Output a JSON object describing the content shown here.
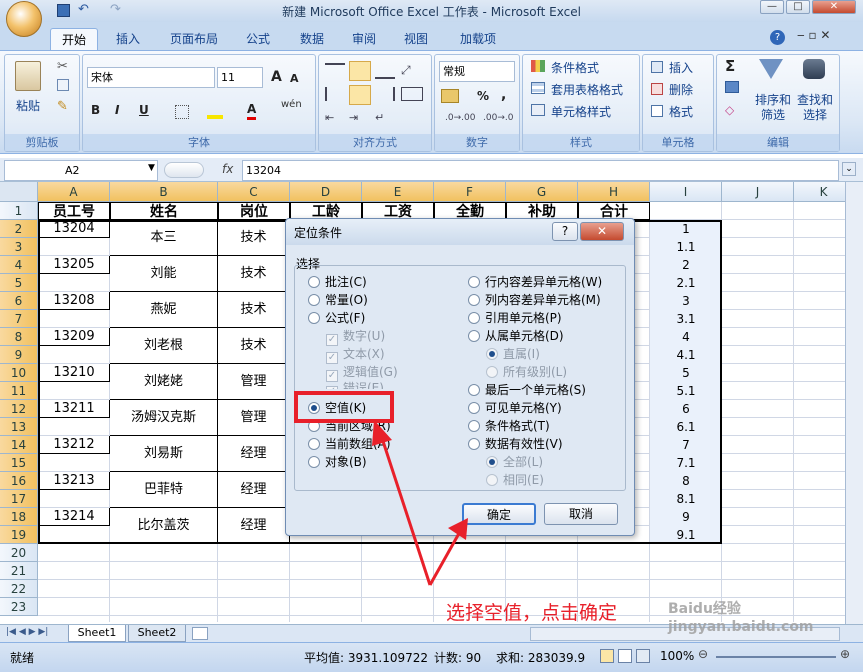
{
  "window": {
    "title": "新建 Microsoft Office Excel 工作表 - Microsoft Excel",
    "min": "—",
    "max": "□",
    "close": "✕"
  },
  "ribbon_tabs": [
    "开始",
    "插入",
    "页面布局",
    "公式",
    "数据",
    "审阅",
    "视图",
    "加载项"
  ],
  "ribbon": {
    "font_name": "宋体",
    "font_size": "11",
    "number_format": "常规",
    "groups": {
      "clipboard": "剪贴板",
      "font": "字体",
      "alignment": "对齐方式",
      "number": "数字",
      "styles": "样式",
      "cells": "单元格",
      "editing": "编辑"
    },
    "paste": "粘贴",
    "styles_items": [
      "条件格式",
      "套用表格格式",
      "单元格样式"
    ],
    "cells_items": [
      "插入",
      "删除",
      "格式"
    ],
    "editing_items": [
      "排序和",
      "筛选",
      "查找和",
      "选择"
    ],
    "sigma": "Σ",
    "bold": "B",
    "italic": "I",
    "underline": "U",
    "font_grow": "A",
    "font_color": "A",
    "wen": "wén",
    "pct": "%",
    "comma": ","
  },
  "formula_bar": {
    "name_box": "A2",
    "fx": "fx",
    "value": "13204"
  },
  "columns": [
    "A",
    "B",
    "C",
    "D",
    "E",
    "F",
    "G",
    "H",
    "I",
    "J",
    "K"
  ],
  "rows": [
    "1",
    "2",
    "3",
    "4",
    "5",
    "6",
    "7",
    "8",
    "9",
    "10",
    "11",
    "12",
    "13",
    "14",
    "15",
    "16",
    "17",
    "18",
    "19",
    "20",
    "21",
    "22",
    "23"
  ],
  "headers": [
    "员工号",
    "姓名",
    "岗位",
    "工龄",
    "工资",
    "全勤",
    "补助",
    "合计"
  ],
  "records": [
    {
      "id": "13204",
      "name": "本三",
      "post": "技术"
    },
    {
      "id": "13205",
      "name": "刘能",
      "post": "技术"
    },
    {
      "id": "13208",
      "name": "燕妮",
      "post": "技术"
    },
    {
      "id": "13209",
      "name": "刘老根",
      "post": "技术"
    },
    {
      "id": "13210",
      "name": "刘姥姥",
      "post": "管理"
    },
    {
      "id": "13211",
      "name": "汤姆汉克斯",
      "post": "管理"
    },
    {
      "id": "13212",
      "name": "刘易斯",
      "post": "经理"
    },
    {
      "id": "13213",
      "name": "巴菲特",
      "post": "经理"
    },
    {
      "id": "13214",
      "name": "比尔盖茨",
      "post": "经理"
    }
  ],
  "col_i_values": [
    "1",
    "1.1",
    "2",
    "2.1",
    "3",
    "3.1",
    "4",
    "4.1",
    "5",
    "5.1",
    "6",
    "6.1",
    "7",
    "7.1",
    "8",
    "8.1",
    "9",
    "9.1"
  ],
  "dialog": {
    "title": "定位条件",
    "help": "?",
    "close": "✕",
    "section": "选择",
    "left_options": [
      "批注(C)",
      "常量(O)",
      "公式(F)"
    ],
    "formula_subs": [
      "数字(U)",
      "文本(X)",
      "逻辑值(G)",
      "错误(E)"
    ],
    "left_options2": [
      "空值(K)",
      "当前区域(R)",
      "当前数组(A)",
      "对象(B)"
    ],
    "right_options": [
      "行内容差异单元格(W)",
      "列内容差异单元格(M)",
      "引用单元格(P)",
      "从属单元格(D)"
    ],
    "dep_subs": [
      "直属(I)",
      "所有级别(L)"
    ],
    "right_options2": [
      "最后一个单元格(S)",
      "可见单元格(Y)",
      "条件格式(T)",
      "数据有效性(V)"
    ],
    "valid_subs": [
      "全部(L)",
      "相同(E)"
    ],
    "ok": "确定",
    "cancel": "取消"
  },
  "annotation": "选择空值，点击确定",
  "sheets": [
    "Sheet1",
    "Sheet2"
  ],
  "status": {
    "ready": "就绪",
    "average": "平均值: 3931.109722",
    "count": "计数: 90",
    "sum": "求和: 283039.9",
    "zoom": "100%"
  },
  "watermark": "Baidu经验 jingyan.baidu.com",
  "colors": {
    "accent": "#15428b",
    "highlight": "#e8202a",
    "selected_header": "#f1c15f"
  }
}
